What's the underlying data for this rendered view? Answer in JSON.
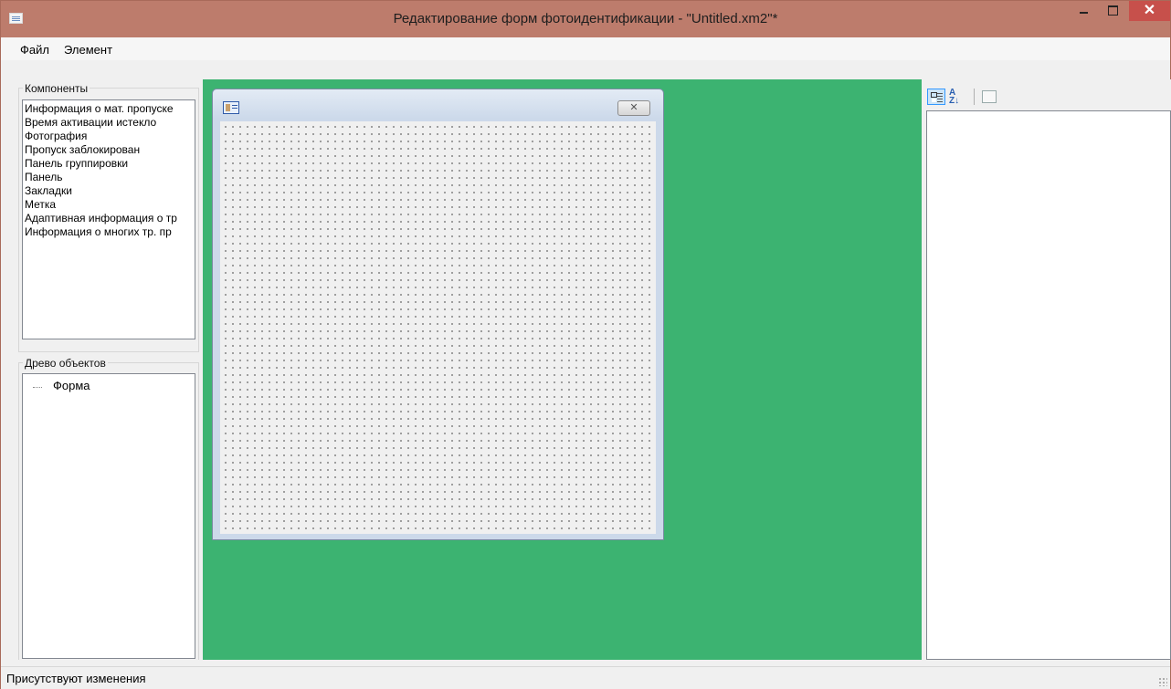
{
  "window": {
    "title": "Редактирование форм фотоидентификации - \"Untitled.xm2\"*",
    "close_glyph": "✕"
  },
  "menu": {
    "items": [
      "Файл",
      "Элемент"
    ]
  },
  "components": {
    "label": "Компоненты",
    "items": [
      "Информация о мат. пропуске",
      "Время активации истекло",
      "Фотография",
      "Пропуск заблокирован",
      "Панель группировки",
      "Панель",
      "Закладки",
      "Метка",
      "Адаптивная информация о тр",
      "Информация о многих тр. пр"
    ]
  },
  "object_tree": {
    "label": "Древо объектов",
    "items": [
      "Форма"
    ]
  },
  "form": {
    "close_glyph": "✕",
    "icon": "id-card-icon"
  },
  "property_grid": {
    "sort_glyph": "A\nZ↓"
  },
  "status": {
    "text": "Присутствуют изменения"
  },
  "colors": {
    "titlebar": "#bd7c6c",
    "canvas": "#3cb371",
    "close_button": "#c7504b",
    "selected_tool": "#cce4f7"
  }
}
